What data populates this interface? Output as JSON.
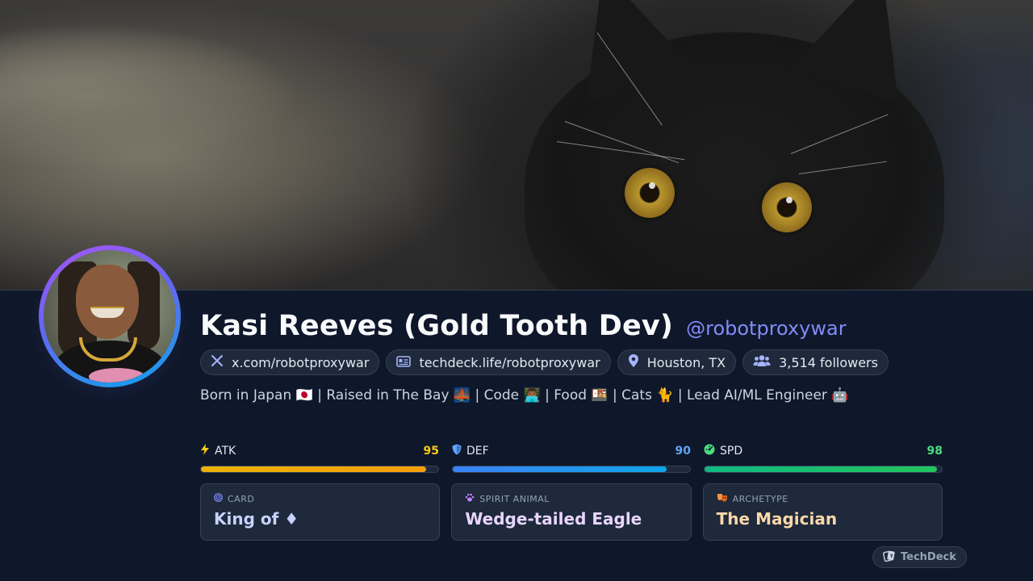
{
  "profile": {
    "name": "Kasi Reeves (Gold Tooth Dev)",
    "handle": "@robotproxywar",
    "bio": "Born in Japan 🇯🇵 | Raised in The Bay 🌉 | Code 👨🏾‍💻 | Food 🍱 | Cats 🐈 | Lead AI/ML Engineer 🤖"
  },
  "links": {
    "x": {
      "icon": "x-logo-icon",
      "label": "x.com/robotproxywar"
    },
    "techdeck": {
      "icon": "id-card-icon",
      "label": "techdeck.life/robotproxywar"
    },
    "location": {
      "icon": "map-pin-icon",
      "label": "Houston, TX"
    },
    "followers": {
      "icon": "users-icon",
      "label": "3,514 followers"
    }
  },
  "stats": {
    "atk": {
      "label": "ATK",
      "value": "95",
      "fraction": 0.95,
      "icon": "lightning-icon",
      "color": "#facc15"
    },
    "def": {
      "label": "DEF",
      "value": "90",
      "fraction": 0.9,
      "icon": "shield-icon",
      "color": "#60a5fa"
    },
    "spd": {
      "label": "SPD",
      "value": "98",
      "fraction": 0.98,
      "icon": "gauge-icon",
      "color": "#4ade80"
    }
  },
  "cards": {
    "card": {
      "label": "CARD",
      "value": "King of ♦",
      "icon": "target-icon",
      "color": "#c7d2fe"
    },
    "spirit": {
      "label": "SPIRIT ANIMAL",
      "value": "Wedge-tailed Eagle",
      "icon": "paw-icon",
      "color": "#e9d5ff"
    },
    "archetype": {
      "label": "ARCHETYPE",
      "value": "The Magician",
      "icon": "masks-icon",
      "color": "#fed7aa"
    }
  },
  "brand": {
    "label": "TechDeck",
    "icon": "techdeck-logo-icon"
  },
  "colors": {
    "background": "#0f172a",
    "accent": "#818cf8",
    "panel": "#1e293b",
    "border": "#334155"
  }
}
